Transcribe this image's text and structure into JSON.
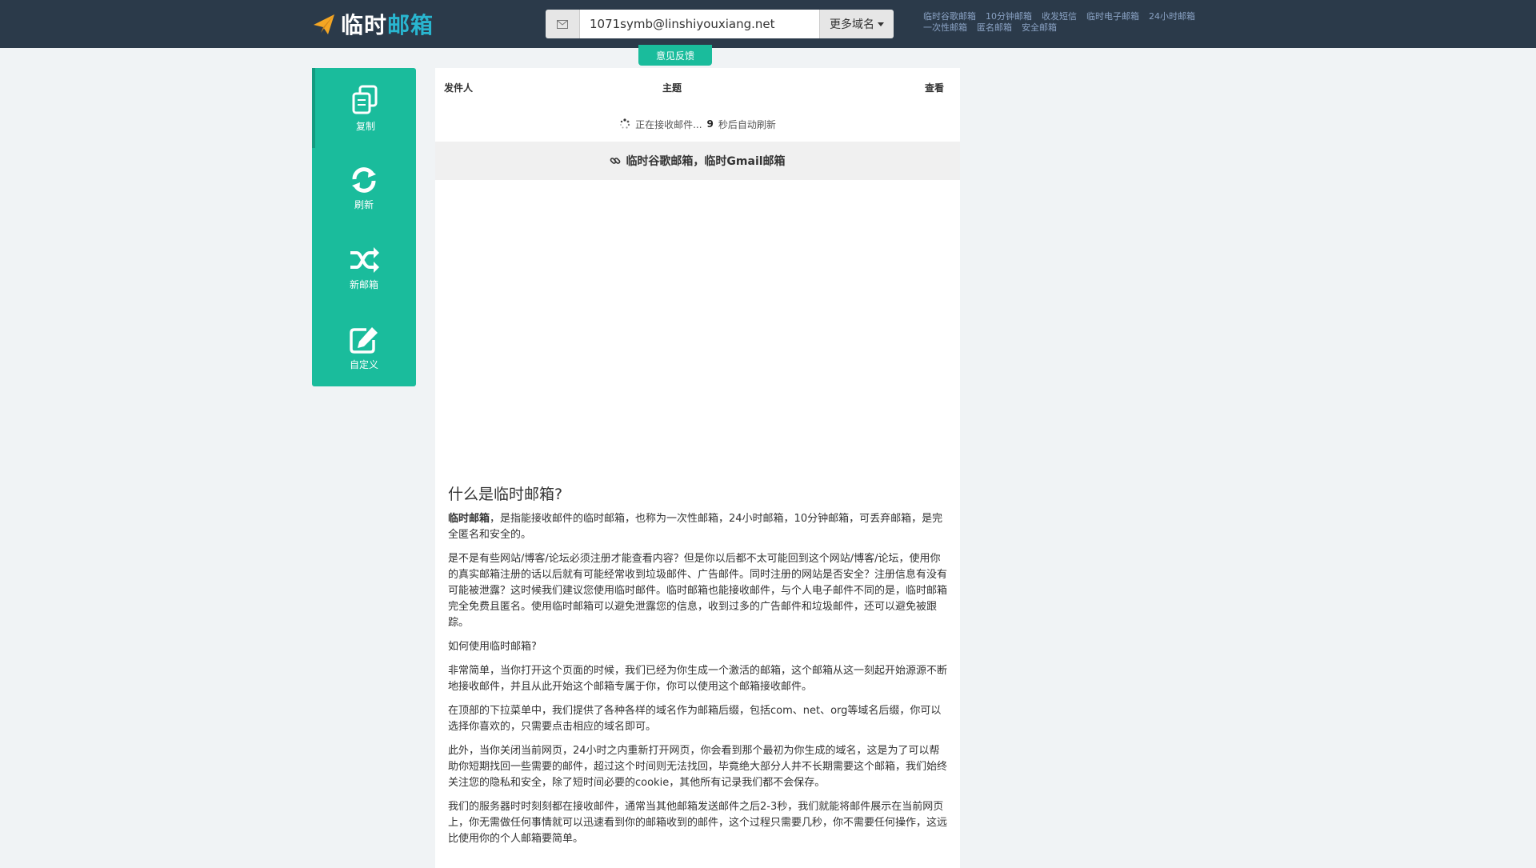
{
  "logo": {
    "text_white": "临时",
    "text_colored": "邮箱"
  },
  "mailbox": {
    "address": "1071symb@linshiyouxiang.net",
    "domain_button": "更多域名"
  },
  "nav_links": [
    "临时谷歌邮箱",
    "10分钟邮箱",
    "收发短信",
    "临时电子邮箱",
    "24小时邮箱",
    "一次性邮箱",
    "匿名邮箱",
    "安全邮箱"
  ],
  "feedback_label": "意见反馈",
  "sidebar": {
    "items": [
      {
        "label": "复制",
        "icon": "copy-icon"
      },
      {
        "label": "刷新",
        "icon": "refresh-icon"
      },
      {
        "label": "新邮箱",
        "icon": "random-icon"
      },
      {
        "label": "自定义",
        "icon": "edit-icon"
      }
    ]
  },
  "table": {
    "col_sender": "发件人",
    "col_subject": "主题",
    "col_view": "查看"
  },
  "status": {
    "prefix": "正在接收邮件...",
    "seconds": "9",
    "suffix": "秒后自动刷新"
  },
  "promo": "临时谷歌邮箱，临时Gmail邮箱",
  "article": {
    "title": "什么是临时邮箱?",
    "p1_bold": "临时邮箱",
    "p1": "，是指能接收邮件的临时邮箱，也称为一次性邮箱，24小时邮箱，10分钟邮箱，可丢弃邮箱，是完全匿名和安全的。",
    "p2": "是不是有些网站/博客/论坛必须注册才能查看内容？但是你以后都不太可能回到这个网站/博客/论坛，使用你的真实邮箱注册的话以后就有可能经常收到垃圾邮件、广告邮件。同时注册的网站是否安全？注册信息有没有可能被泄露？这时候我们建议您使用临时邮件。临时邮箱也能接收邮件，与个人电子邮件不同的是，临时邮箱完全免费且匿名。使用临时邮箱可以避免泄露您的信息，收到过多的广告邮件和垃圾邮件，还可以避免被跟踪。",
    "p3": "如何使用临时邮箱?",
    "p4": "非常简单，当你打开这个页面的时候，我们已经为你生成一个激活的邮箱，这个邮箱从这一刻起开始源源不断地接收邮件，并且从此开始这个邮箱专属于你，你可以使用这个邮箱接收邮件。",
    "p5": "在顶部的下拉菜单中，我们提供了各种各样的域名作为邮箱后缀，包括com、net、org等域名后缀，你可以选择你喜欢的，只需要点击相应的域名即可。",
    "p6": "此外，当你关闭当前网页，24小时之内重新打开网页，你会看到那个最初为你生成的域名，这是为了可以帮助你短期找回一些需要的邮件，超过这个时间则无法找回，毕竟绝大部分人并不长期需要这个邮箱，我们始终关注您的隐私和安全，除了短时间必要的cookie，其他所有记录我们都不会保存。",
    "p7": "我们的服务器时时刻刻都在接收邮件，通常当其他邮箱发送邮件之后2-3秒，我们就能将邮件展示在当前网页上，你无需做任何事情就可以迅速看到你的邮箱收到的邮件，这个过程只需要几秒，你不需要任何操作，这远比使用你的个人邮箱要简单。"
  },
  "colors": {
    "navbar": "#2b3a4a",
    "accent": "#1abc9c",
    "logo_accent": "#29b6d0",
    "page_bg": "#f0f3f5"
  }
}
